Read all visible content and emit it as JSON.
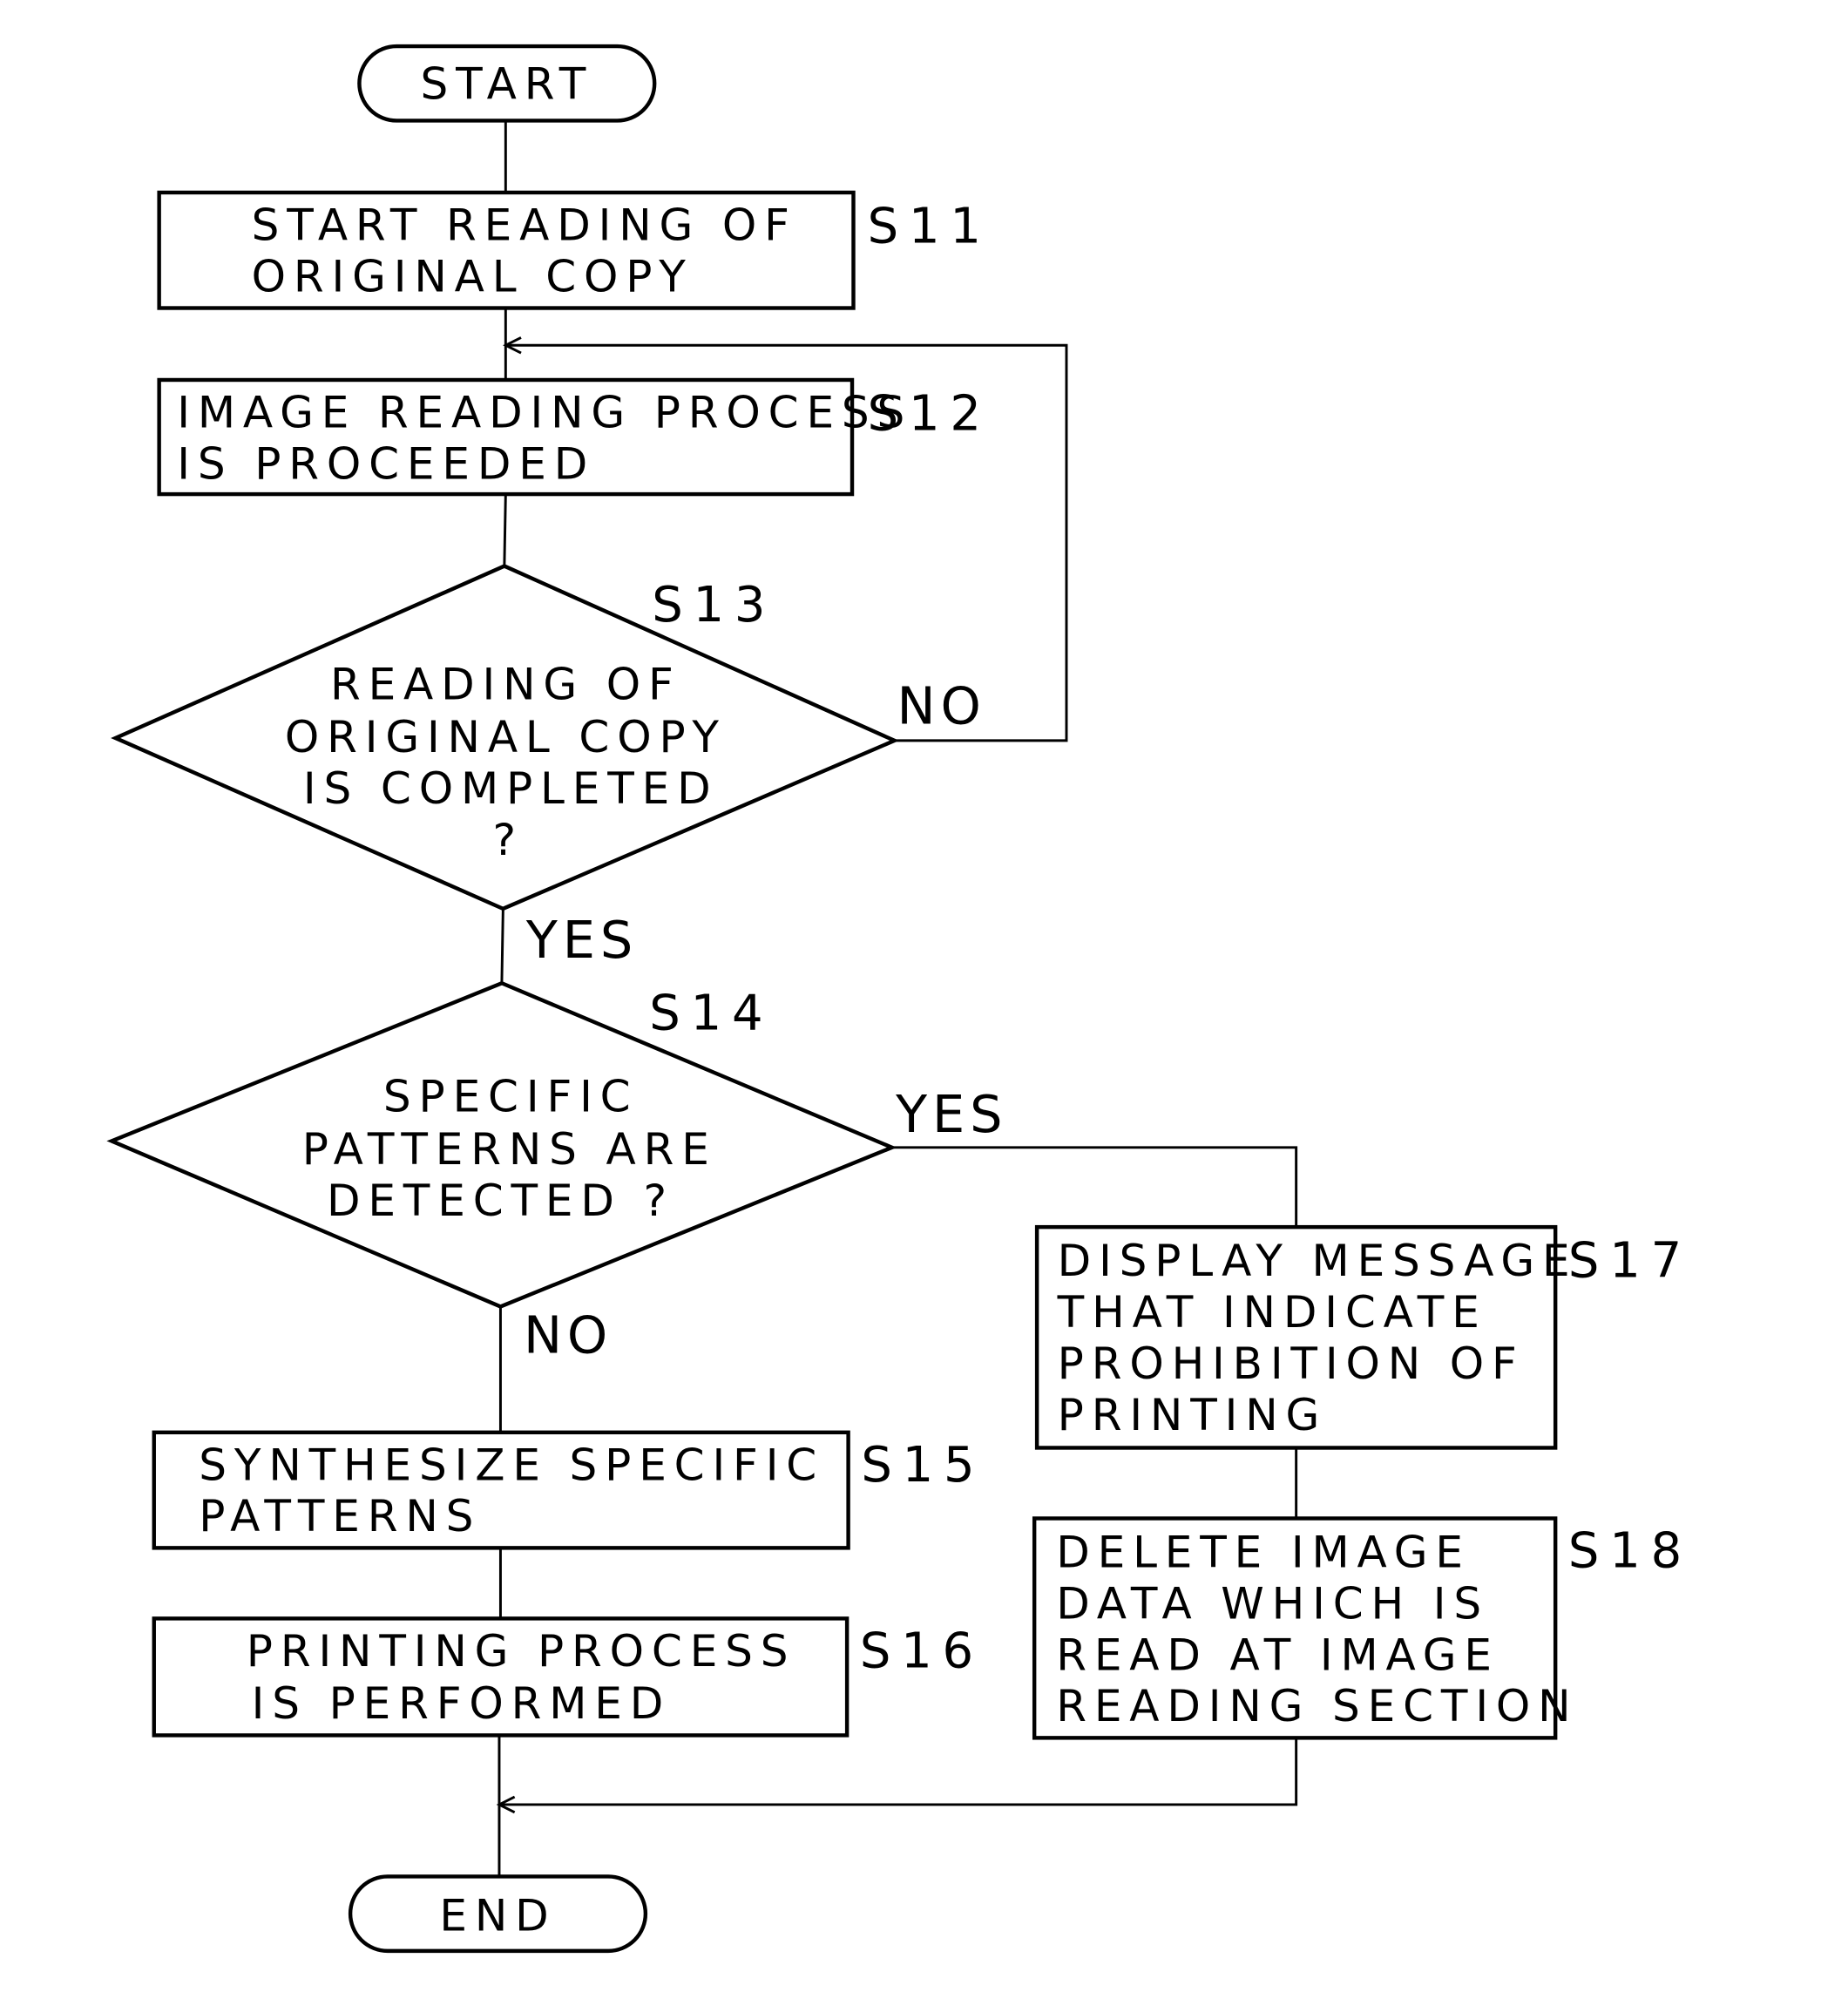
{
  "diagram": {
    "type": "flowchart",
    "colors": {
      "stroke": "#000000",
      "background": "#ffffff"
    },
    "terminals": {
      "start": {
        "label": "START"
      },
      "end": {
        "label": "END"
      }
    },
    "steps": {
      "s11": {
        "id": "S11",
        "lines": [
          "START READING OF",
          "ORIGINAL COPY"
        ]
      },
      "s12": {
        "id": "S12",
        "lines": [
          "IMAGE READING PROCESS",
          "IS PROCEEDED"
        ]
      },
      "s13": {
        "id": "S13",
        "lines": [
          "READING OF",
          "ORIGINAL COPY",
          "IS COMPLETED",
          "?"
        ]
      },
      "s14": {
        "id": "S14",
        "lines": [
          "SPECIFIC",
          "PATTERNS ARE",
          "DETECTED ?"
        ]
      },
      "s15": {
        "id": "S15",
        "lines": [
          "SYNTHESIZE SPECIFIC",
          "PATTERNS"
        ]
      },
      "s16": {
        "id": "S16",
        "lines": [
          "PRINTING PROCESS",
          "IS PERFORMED"
        ]
      },
      "s17": {
        "id": "S17",
        "lines": [
          "DISPLAY MESSAGE",
          "THAT INDICATE",
          "PROHIBITION OF",
          "PRINTING"
        ]
      },
      "s18": {
        "id": "S18",
        "lines": [
          "DELETE IMAGE",
          "DATA WHICH IS",
          "READ AT IMAGE",
          "READING SECTION"
        ]
      }
    },
    "branches": {
      "s13_no": "NO",
      "s13_yes": "YES",
      "s14_yes": "YES",
      "s14_no": "NO"
    },
    "edges": [
      {
        "from": "START",
        "to": "S11"
      },
      {
        "from": "S11",
        "to": "S12"
      },
      {
        "from": "S12",
        "to": "S13"
      },
      {
        "from": "S13",
        "to": "S12",
        "label": "NO"
      },
      {
        "from": "S13",
        "to": "S14",
        "label": "YES"
      },
      {
        "from": "S14",
        "to": "S17",
        "label": "YES"
      },
      {
        "from": "S14",
        "to": "S15",
        "label": "NO"
      },
      {
        "from": "S15",
        "to": "S16"
      },
      {
        "from": "S17",
        "to": "S18"
      },
      {
        "from": "S16",
        "to": "END"
      },
      {
        "from": "S18",
        "to": "END"
      }
    ]
  }
}
